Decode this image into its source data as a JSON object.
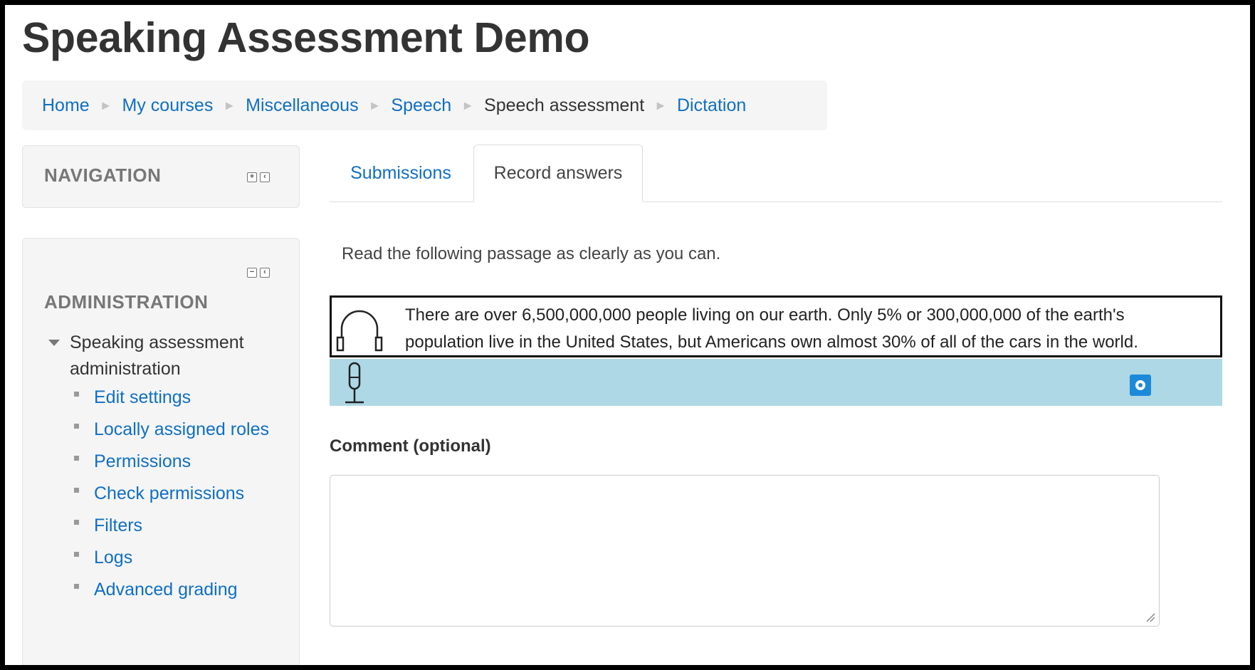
{
  "page": {
    "title": "Speaking Assessment Demo"
  },
  "breadcrumb": {
    "items": [
      {
        "label": "Home",
        "link": true
      },
      {
        "label": "My courses",
        "link": true
      },
      {
        "label": "Miscellaneous",
        "link": true
      },
      {
        "label": "Speech",
        "link": true
      },
      {
        "label": "Speech assessment",
        "link": false
      },
      {
        "label": "Dictation",
        "link": true
      }
    ],
    "separator": "►"
  },
  "navigation_block": {
    "title": "NAVIGATION"
  },
  "administration_block": {
    "title": "ADMINISTRATION",
    "section_label": "Speaking assessment administration",
    "items": [
      {
        "label": "Edit settings"
      },
      {
        "label": "Locally assigned roles"
      },
      {
        "label": "Permissions"
      },
      {
        "label": "Check permissions"
      },
      {
        "label": "Filters"
      },
      {
        "label": "Logs"
      },
      {
        "label": "Advanced grading"
      }
    ]
  },
  "tabs": [
    {
      "label": "Submissions",
      "active": false
    },
    {
      "label": "Record answers",
      "active": true
    }
  ],
  "instruction": "Read the following passage as clearly as you can.",
  "passage": {
    "line1": "There are over 6,500,000,000 people living on our earth. Only 5% or 300,000,000 of the earth's",
    "line2": "population live in the United States, but Americans own almost 30% of all of the cars in the world."
  },
  "recorder": {
    "bar_color": "#aed8e6",
    "record_icon": "record-icon"
  },
  "comment": {
    "label": "Comment (optional)",
    "value": ""
  },
  "colors": {
    "link": "#0f6fc5",
    "block_bg": "#f5f5f5"
  }
}
